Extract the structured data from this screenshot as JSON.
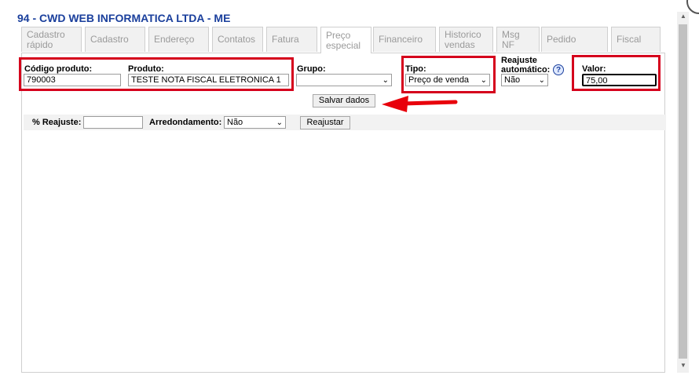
{
  "header": {
    "title": "94 - CWD WEB INFORMATICA LTDA - ME"
  },
  "tabs": [
    {
      "label": "Cadastro rápido"
    },
    {
      "label": "Cadastro"
    },
    {
      "label": "Endereço"
    },
    {
      "label": "Contatos"
    },
    {
      "label": "Fatura"
    },
    {
      "label": "Preço especial",
      "active": true
    },
    {
      "label": "Financeiro"
    },
    {
      "label": "Historico vendas"
    },
    {
      "label": "Msg NF"
    },
    {
      "label": "Pedido"
    },
    {
      "label": "Fiscal"
    }
  ],
  "form": {
    "codigo_label": "Código produto:",
    "codigo_value": "790003",
    "produto_label": "Produto:",
    "produto_value": "TESTE  NOTA FISCAL  ELETRONICA 1",
    "grupo_label": "Grupo:",
    "grupo_value": "",
    "tipo_label": "Tipo:",
    "tipo_value": "Preço de venda",
    "reajuste_auto_label": "Reajuste automático:",
    "reajuste_auto_value": "Não",
    "valor_label": "Valor:",
    "valor_value": "75,00",
    "save_label": "Salvar dados"
  },
  "reajuste": {
    "percent_label": "% Reajuste:",
    "percent_value": "",
    "arred_label": "Arredondamento:",
    "arred_value": "Não",
    "button_label": "Reajustar"
  },
  "colors": {
    "highlight": "#d5001c",
    "title": "#1a3f9c"
  },
  "icons": {
    "help": "question-circle-icon",
    "arrow": "red-arrow-left-icon"
  }
}
